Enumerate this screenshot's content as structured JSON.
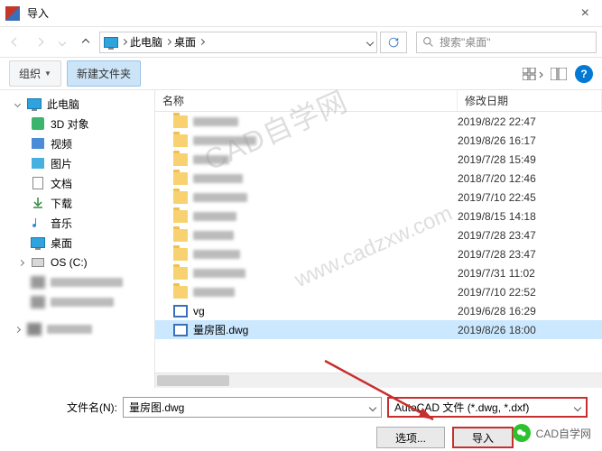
{
  "window": {
    "title": "导入"
  },
  "nav": {
    "crumbs": [
      "此电脑",
      "桌面"
    ],
    "search_placeholder": "搜索\"桌面\""
  },
  "toolbar": {
    "organize": "组织",
    "new_folder": "新建文件夹"
  },
  "tree": {
    "this_pc": "此电脑",
    "items": [
      {
        "label": "3D 对象"
      },
      {
        "label": "视频"
      },
      {
        "label": "图片"
      },
      {
        "label": "文档"
      },
      {
        "label": "下载"
      },
      {
        "label": "音乐"
      },
      {
        "label": "桌面"
      },
      {
        "label": "OS (C:)"
      }
    ]
  },
  "columns": {
    "name": "名称",
    "modified": "修改日期"
  },
  "files": [
    {
      "name": "",
      "date": "2019/8/22 22:47",
      "type": "folder",
      "blur": 50
    },
    {
      "name": "",
      "date": "2019/8/26 16:17",
      "type": "folder",
      "blur": 70
    },
    {
      "name": "",
      "date": "2019/7/28 15:49",
      "type": "folder",
      "blur": 40
    },
    {
      "name": "",
      "date": "2018/7/20 12:46",
      "type": "folder",
      "blur": 55
    },
    {
      "name": "",
      "date": "2019/7/10 22:45",
      "type": "folder",
      "blur": 60
    },
    {
      "name": "",
      "date": "2019/8/15 14:18",
      "type": "folder",
      "blur": 48
    },
    {
      "name": "",
      "date": "2019/7/28 23:47",
      "type": "folder",
      "blur": 45
    },
    {
      "name": "",
      "date": "2019/7/28 23:47",
      "type": "folder",
      "blur": 52
    },
    {
      "name": "",
      "date": "2019/7/31 11:02",
      "type": "folder",
      "blur": 58
    },
    {
      "name": "",
      "date": "2019/7/10 22:52",
      "type": "folder",
      "blur": 46
    },
    {
      "name": "vg",
      "date": "2019/6/28 16:29",
      "type": "dwg",
      "blur": 40
    },
    {
      "name": "量房图.dwg",
      "date": "2019/8/26 18:00",
      "type": "dwg",
      "selected": true
    }
  ],
  "footer": {
    "filename_label": "文件名(N):",
    "filename_value": "量房图.dwg",
    "filetype_value": "AutoCAD 文件 (*.dwg, *.dxf)",
    "options": "选项...",
    "import": "导入"
  },
  "watermark1": "CAD自学网",
  "watermark2": "www.cadzxw.com",
  "credit": "CAD自学网"
}
